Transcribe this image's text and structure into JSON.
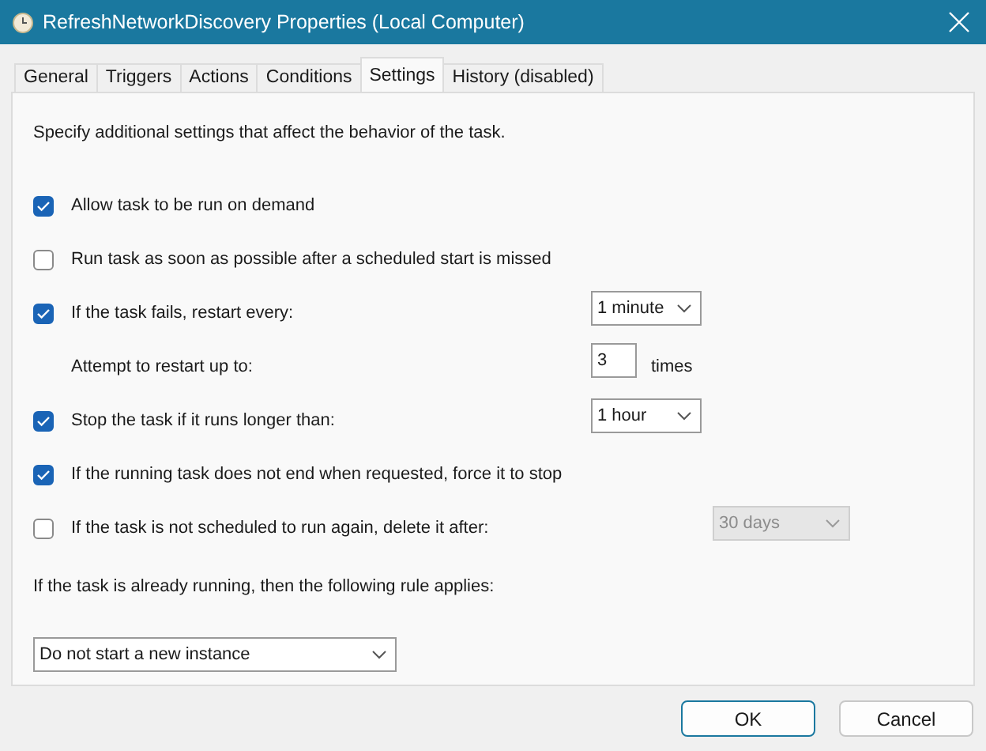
{
  "window": {
    "title": "RefreshNetworkDiscovery Properties (Local Computer)"
  },
  "tabs": [
    {
      "label": "General",
      "selected": false
    },
    {
      "label": "Triggers",
      "selected": false
    },
    {
      "label": "Actions",
      "selected": false
    },
    {
      "label": "Conditions",
      "selected": false
    },
    {
      "label": "Settings",
      "selected": true
    },
    {
      "label": "History (disabled)",
      "selected": false
    }
  ],
  "description": "Specify additional settings that affect the behavior of the task.",
  "settings": [
    {
      "kind": "check",
      "label": "Allow task to be run on demand",
      "checked": true
    },
    {
      "kind": "check",
      "label": "Run task as soon as possible after a scheduled start is missed",
      "checked": false
    },
    {
      "kind": "check",
      "label": "If the task fails, restart every:",
      "checked": true,
      "control": {
        "kind": "select",
        "value": "1 minute",
        "disabled": false
      }
    },
    {
      "kind": "plain",
      "label": "Attempt to restart up to:",
      "control": {
        "kind": "number",
        "value": "3",
        "suffix": "times"
      }
    },
    {
      "kind": "check",
      "label": "Stop the task if it runs longer than:",
      "checked": true,
      "control": {
        "kind": "select",
        "value": "1 hour",
        "disabled": false
      }
    },
    {
      "kind": "check",
      "label": "If the running task does not end when requested, force it to stop",
      "checked": true
    },
    {
      "kind": "check",
      "label": "If the task is not scheduled to run again, delete it after:",
      "checked": false,
      "control": {
        "kind": "select",
        "value": "30 days",
        "disabled": true
      }
    }
  ],
  "rule": {
    "label": "If the task is already running, then the following rule applies:",
    "value": "Do not start a new instance"
  },
  "buttons": [
    {
      "label": "OK",
      "default": true
    },
    {
      "label": "Cancel",
      "default": false
    }
  ]
}
